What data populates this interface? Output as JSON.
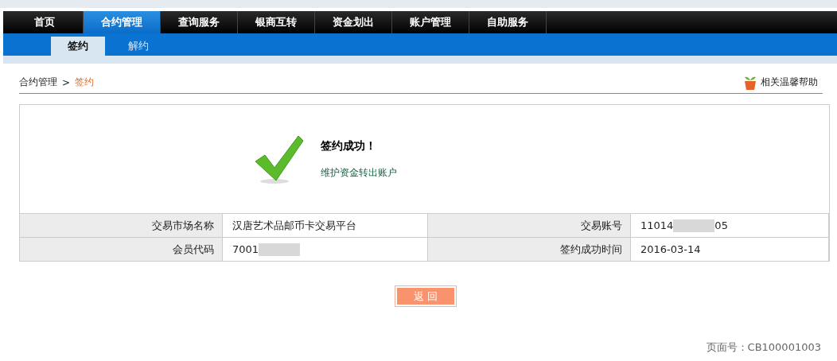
{
  "nav": {
    "items": [
      {
        "label": "首页",
        "selected": false
      },
      {
        "label": "合约管理",
        "selected": true
      },
      {
        "label": "查询服务",
        "selected": false
      },
      {
        "label": "银商互转",
        "selected": false
      },
      {
        "label": "资金划出",
        "selected": false
      },
      {
        "label": "账户管理",
        "selected": false
      },
      {
        "label": "自助服务",
        "selected": false
      }
    ]
  },
  "subnav": {
    "items": [
      {
        "label": "签约",
        "selected": true
      },
      {
        "label": "解约",
        "selected": false
      }
    ]
  },
  "breadcrumb": {
    "parent": "合约管理",
    "separator": ">",
    "current": "签约"
  },
  "help_link": "相关温馨帮助",
  "result": {
    "title": "签约成功！",
    "link": "维护资金转出账户"
  },
  "details": [
    {
      "label": "交易市场名称",
      "value_start": "汉唐艺术品邮币卡交易平台"
    },
    {
      "label": "交易账号",
      "value_start": "11014",
      "value_end": "05",
      "masked": true
    },
    {
      "label": "会员代码",
      "value_start": "7001",
      "masked": true
    },
    {
      "label": "签约成功时间",
      "value_start": "2016-03-14"
    }
  ],
  "back_button": "返 回",
  "page_number": "页面号：CB100001003"
}
